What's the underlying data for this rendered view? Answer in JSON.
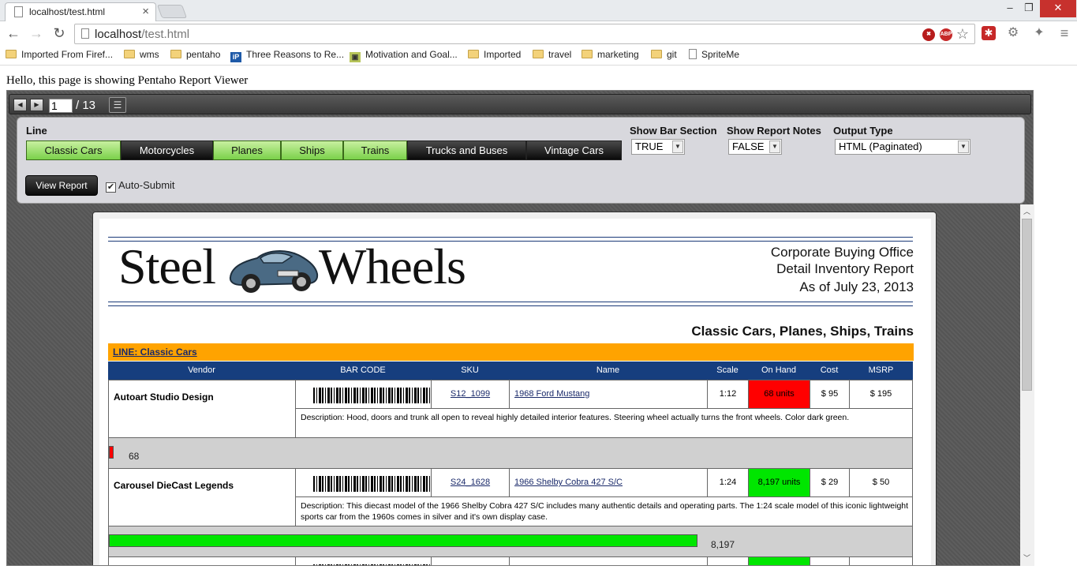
{
  "browser": {
    "tab_title": "localhost/test.html",
    "tab_close": "×",
    "url_host": "localhost",
    "url_path": "/test.html",
    "window_minimize": "–",
    "window_restore": "❐",
    "window_close": "✕",
    "bookmarks": [
      "Imported From Firef...",
      "wms",
      "pentaho",
      "Three Reasons to Re...",
      "Motivation and Goal...",
      "Imported",
      "travel",
      "marketing",
      "git",
      "SpriteMe"
    ]
  },
  "page": {
    "hello": "Hello, this page is showing Pentaho Report Viewer"
  },
  "pager": {
    "prev_icon": "◀",
    "next_icon": "▶",
    "current_page": "1",
    "total_label": "/ 13",
    "list_icon": "☰"
  },
  "params": {
    "line_label": "Line",
    "line_options": [
      {
        "label": "Classic Cars",
        "selected": true
      },
      {
        "label": "Motorcycles",
        "selected": false
      },
      {
        "label": "Planes",
        "selected": true
      },
      {
        "label": "Ships",
        "selected": true
      },
      {
        "label": "Trains",
        "selected": true
      },
      {
        "label": "Trucks and Buses",
        "selected": false
      },
      {
        "label": "Vintage Cars",
        "selected": false
      }
    ],
    "bar_section_label": "Show Bar Section",
    "bar_section_value": "TRUE",
    "report_notes_label": "Show Report Notes",
    "report_notes_value": "FALSE",
    "output_type_label": "Output Type",
    "output_type_value": "HTML (Paginated)",
    "view_report": "View Report",
    "auto_submit": "Auto-Submit",
    "auto_submit_checked": "✔"
  },
  "report": {
    "logo_left": "Steel",
    "logo_right": "Wheels",
    "header_lines": [
      "Corporate Buying Office",
      "Detail Inventory Report",
      "As of July 23, 2013"
    ],
    "lines_title": "Classic Cars,   Planes,   Ships,   Trains",
    "line_heading": "LINE:   Classic   Cars",
    "columns": [
      "Vendor",
      "BAR CODE",
      "SKU",
      "Name",
      "Scale",
      "On Hand",
      "Cost",
      "MSRP"
    ],
    "rows": [
      {
        "vendor": "Autoart Studio Design",
        "sku": "S12_1099",
        "name": "1968 Ford Mustang",
        "scale": "1:12",
        "on_hand": "68 units",
        "on_hand_color": "#ff0000",
        "cost": "$ 95",
        "msrp": "$ 195",
        "description": "Description: Hood, doors and trunk all open to reveal highly detailed interior features. Steering wheel actually turns the front wheels. Color dark green.",
        "bar_value": "68",
        "bar_fraction": 0.0068,
        "bar_color": "#ff0000"
      },
      {
        "vendor": "Carousel DieCast Legends",
        "sku": "S24_1628",
        "name": "1966 Shelby Cobra 427 S/C",
        "scale": "1:24",
        "on_hand": "8,197 units",
        "on_hand_color": "#00e600",
        "cost": "$ 29",
        "msrp": "$ 50",
        "description": "Description: This diecast model of the 1966 Shelby Cobra 427 S/C includes many authentic details and operating parts. The 1:24 scale model of this iconic lightweight sports car from the 1960s comes in silver and it's own display case.",
        "bar_value": "8,197",
        "bar_fraction": 0.8197,
        "bar_color": "#00e600"
      }
    ]
  }
}
